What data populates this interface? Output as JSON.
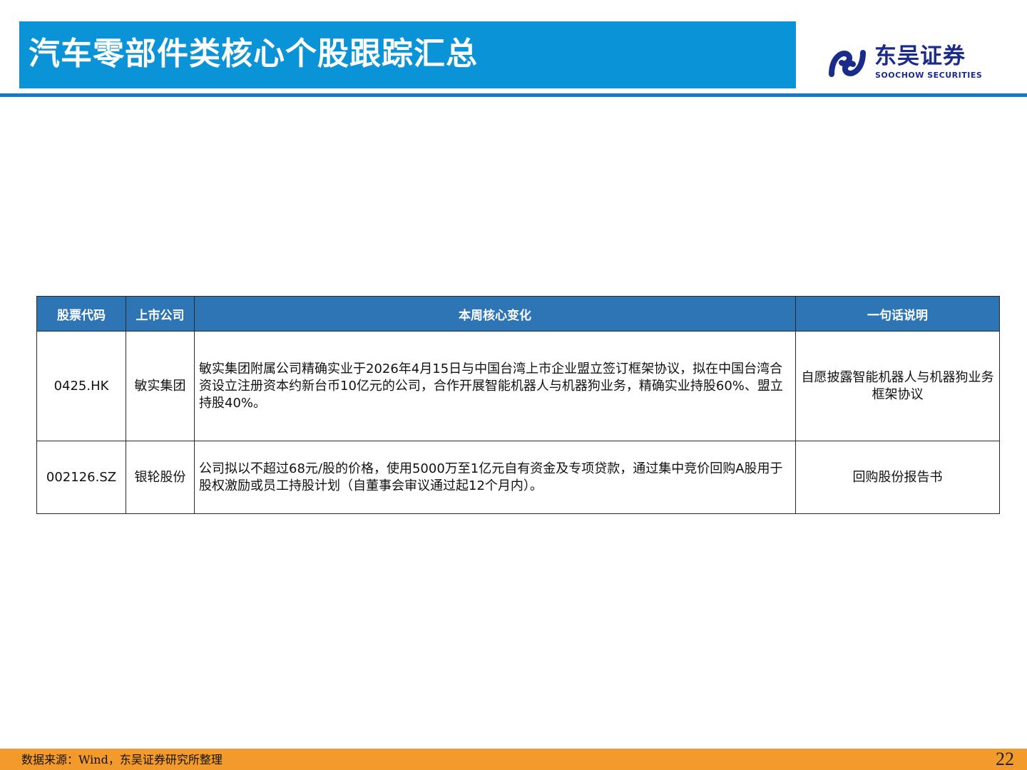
{
  "header": {
    "title": "汽车零部件类核心个股跟踪汇总",
    "logo": {
      "cn": "东吴证券",
      "en": "SOOCHOW SECURITIES",
      "icon": "soochow-logo-mark",
      "color": "#1a2b8c"
    },
    "bar_color": "#0a93d6"
  },
  "table": {
    "headers": [
      "股票代码",
      "上市公司",
      "本周核心变化",
      "一句话说明"
    ],
    "header_color": "#2e75b6",
    "rows": [
      {
        "code": "0425.HK",
        "company": "敏实集团",
        "change": "敏实集团附属公司精确实业于2026年4月15日与中国台湾上市企业盟立签订框架协议，拟在中国台湾合资设立注册资本约新台币10亿元的公司，合作开展智能机器人与机器狗业务，精确实业持股60%、盟立持股40%。",
        "summary": "自愿披露智能机器人与机器狗业务框架协议"
      },
      {
        "code": "002126.SZ",
        "company": "银轮股份",
        "change": "公司拟以不超过68元/股的价格，使用5000万至1亿元自有资金及专项贷款，通过集中竞价回购A股用于股权激励或员工持股计划（自董事会审议通过起12个月内）。",
        "summary": "回购股份报告书"
      }
    ]
  },
  "footer": {
    "source": "数据来源：Wind，东吴证券研究所整理",
    "page": "22",
    "bar_color": "#f39a2d"
  }
}
